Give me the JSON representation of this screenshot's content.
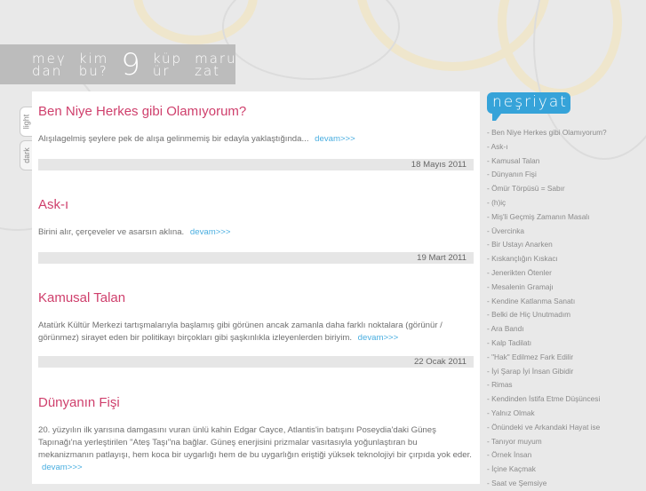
{
  "nav": [
    {
      "l1": "meү",
      "l2": "dan"
    },
    {
      "l1": "kim",
      "l2": "bu?"
    },
    {
      "l1": "9",
      "l2": ""
    },
    {
      "l1": "küp",
      "l2": "ür"
    },
    {
      "l1": "maru",
      "l2": "zat"
    }
  ],
  "theme_tabs": [
    "light",
    "dark"
  ],
  "posts": [
    {
      "title": "Ben Niye Herkes gibi Olamıyorum?",
      "excerpt": "Alışılagelmiş şeylere pek de alışa gelinmemiş bir edayla yaklaştığında...",
      "more": "devam>>>",
      "date": "18 Mayıs 2011"
    },
    {
      "title": "Ask-ı",
      "excerpt": "Birini alır, çerçeveler ve asarsın aklına.",
      "more": "devam>>>",
      "date": "19 Mart 2011"
    },
    {
      "title": "Kamusal Talan",
      "excerpt": "Atatürk Kültür Merkezi tartışmalarıyla başlamış gibi görünen ancak zamanla daha farklı noktalara (görünür / görünmez) sirayet eden bir politikayı birçokları gibi şaşkınlıkla izleyenlerden biriyim.",
      "more": "devam>>>",
      "date": "22 Ocak 2011"
    },
    {
      "title": "Dünyanın Fişi",
      "excerpt": "20. yüzyılın ilk yarısına damgasını vuran ünlü kahin Edgar Cayce, Atlantis'in batışını Poseydia'daki Güneş Tapınağı'na yerleştirilen \"Ateş Taşı\"na bağlar. Güneş enerjisini prizmalar vasıtasıyla yoğunlaştıran bu mekanizmanın patlayışı, hem koca bir uygarlığı hem de bu uygarlığın eriştiği yüksek teknolojiyi bir çırpıda yok eder.",
      "more": "devam>>>",
      "date": ""
    }
  ],
  "sidebar": {
    "title": "neşriyat",
    "items": [
      "- Ben Niye Herkes gibi Olamıyorum?",
      "- Ask-ı",
      "- Kamusal Talan",
      "- Dünyanın Fişi",
      "- Ömür Törpüsü = Sabır",
      "- (h)iç",
      "- Miş'li Geçmiş Zamanın Masalı",
      "- Üvercinka",
      "- Bir Ustayı Anarken",
      "- Kıskançlığın Kıskacı",
      "- Jenerikten Ötenler",
      "- Mesalenin Gramajı",
      "- Kendine Katlanma Sanatı",
      "- Belki de Hiç Unutmadım",
      "- Ara Bandı",
      "- Kalp Tadilatı",
      "- \"Hak\" Edilmez Fark Edilir",
      "- İyi Şarap İyi İnsan Gibidir",
      "- Rimas",
      "- Kendinden İstifa Etme Düşüncesi",
      "- Yalnız Olmak",
      "- Önündeki ve Arkandaki Hayat ise",
      "- Tanıyor muyum",
      "- Örnek İnsan",
      "- İçine Kaçmak",
      "- Saat ve Şemsiye"
    ]
  }
}
